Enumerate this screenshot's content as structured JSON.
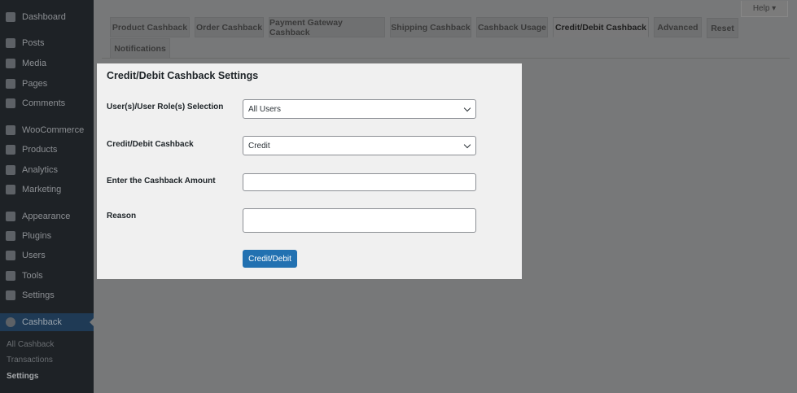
{
  "sidebar": {
    "items": [
      {
        "label": "Dashboard",
        "icon": "dashboard-icon"
      },
      {
        "label": "Posts",
        "icon": "pin-icon"
      },
      {
        "label": "Media",
        "icon": "media-icon"
      },
      {
        "label": "Pages",
        "icon": "pages-icon"
      },
      {
        "label": "Comments",
        "icon": "comments-icon"
      },
      {
        "label": "WooCommerce",
        "icon": "woocommerce-icon"
      },
      {
        "label": "Products",
        "icon": "products-icon"
      },
      {
        "label": "Analytics",
        "icon": "analytics-icon"
      },
      {
        "label": "Marketing",
        "icon": "megaphone-icon"
      },
      {
        "label": "Appearance",
        "icon": "brush-icon"
      },
      {
        "label": "Plugins",
        "icon": "plugin-icon"
      },
      {
        "label": "Users",
        "icon": "user-icon"
      },
      {
        "label": "Tools",
        "icon": "wrench-icon"
      },
      {
        "label": "Settings",
        "icon": "settings-icon"
      },
      {
        "label": "Cashback",
        "icon": "cashback-icon"
      }
    ],
    "submenu": [
      "All Cashback",
      "Transactions",
      "Settings"
    ]
  },
  "help_label": "Help ▾",
  "tabs": [
    "Product Cashback",
    "Order Cashback",
    "Payment Gateway Cashback",
    "Shipping Cashback",
    "Cashback Usage",
    "Credit/Debit Cashback",
    "Advanced",
    "Reset",
    "Notifications"
  ],
  "modal": {
    "title": "Credit/Debit Cashback Settings",
    "users_label": "User(s)/User Role(s) Selection",
    "users_value": "All Users",
    "type_label": "Credit/Debit Cashback",
    "type_value": "Credit",
    "amount_label": "Enter the Cashback Amount",
    "amount_value": "",
    "reason_label": "Reason",
    "reason_value": "",
    "submit": "Credit/Debit"
  }
}
